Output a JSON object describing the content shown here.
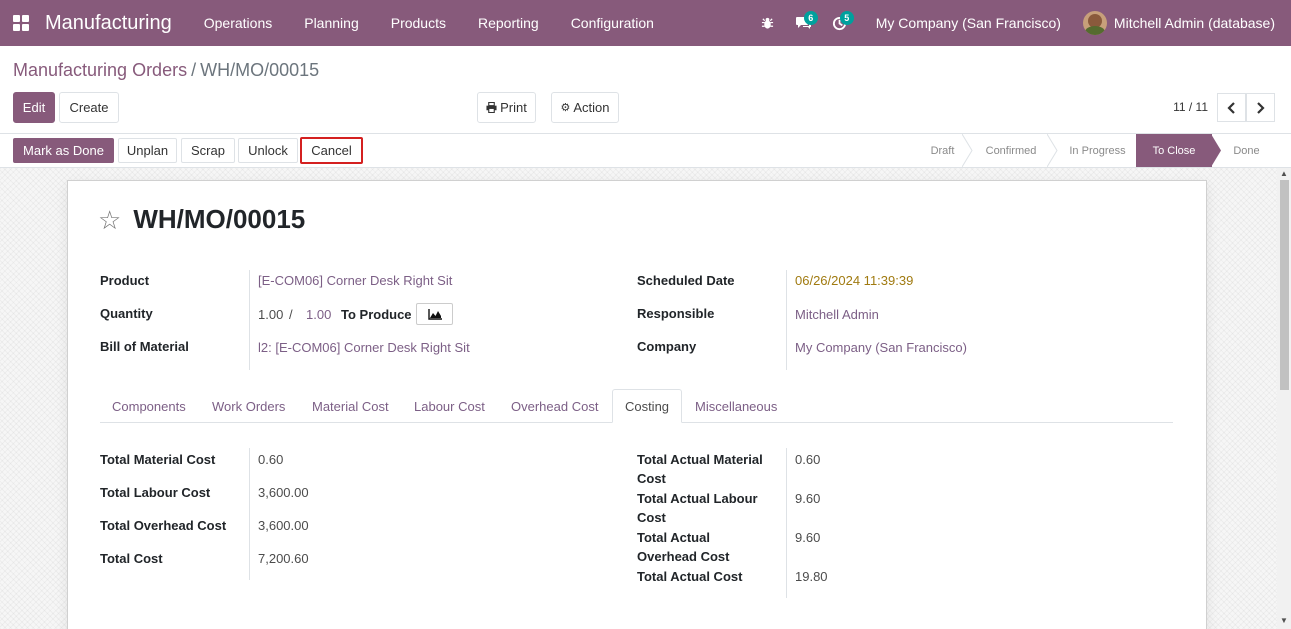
{
  "navbar": {
    "app_name": "Manufacturing",
    "menus": [
      "Operations",
      "Planning",
      "Products",
      "Reporting",
      "Configuration"
    ],
    "messages_badge": "6",
    "activity_badge": "5",
    "company": "My Company (San Francisco)",
    "user": "Mitchell Admin (database)"
  },
  "breadcrumb": {
    "parent": "Manufacturing Orders",
    "separator": "/",
    "current": "WH/MO/00015"
  },
  "control": {
    "edit": "Edit",
    "create": "Create",
    "print": "Print",
    "action": "Action",
    "pager": "11 / 11"
  },
  "statusbar": {
    "buttons": [
      "Mark as Done",
      "Unplan",
      "Scrap",
      "Unlock",
      "Cancel"
    ],
    "stages": [
      "Draft",
      "Confirmed",
      "In Progress",
      "To Close",
      "Done"
    ],
    "active_stage": "To Close"
  },
  "record": {
    "name": "WH/MO/00015",
    "product_label": "Product",
    "product": "[E-COM06] Corner Desk Right Sit",
    "quantity_label": "Quantity",
    "qty_produced": "1.00",
    "qty_sep": "/",
    "qty_total": "1.00",
    "to_produce": "To Produce",
    "bom_label": "Bill of Material",
    "bom": "l2: [E-COM06] Corner Desk Right Sit",
    "scheduled_label": "Scheduled Date",
    "scheduled": "06/26/2024 11:39:39",
    "responsible_label": "Responsible",
    "responsible": "Mitchell Admin",
    "company_label": "Company",
    "company": "My Company (San Francisco)"
  },
  "tabs": [
    "Components",
    "Work Orders",
    "Material Cost",
    "Labour Cost",
    "Overhead Cost",
    "Costing",
    "Miscellaneous"
  ],
  "active_tab": "Costing",
  "costing": {
    "left": [
      {
        "label": "Total Material Cost",
        "value": "0.60"
      },
      {
        "label": "Total Labour Cost",
        "value": "3,600.00"
      },
      {
        "label": "Total Overhead Cost",
        "value": "3,600.00"
      },
      {
        "label": "Total Cost",
        "value": "7,200.60"
      }
    ],
    "right": [
      {
        "label_1": "Total Actual Material",
        "label_2": "Cost",
        "value": "0.60"
      },
      {
        "label_1": "Total Actual Labour",
        "label_2": "Cost",
        "value": "9.60"
      },
      {
        "label_1": "Total Actual",
        "label_2": "Overhead Cost",
        "value": "9.60"
      },
      {
        "label_1": "Total Actual Cost",
        "label_2": "",
        "value": "19.80"
      }
    ]
  },
  "colors": {
    "brand": "#875a7b",
    "link": "#7c5f86",
    "badge": "#00a09d",
    "warning": "#a07a10",
    "highlight": "#d42020"
  }
}
